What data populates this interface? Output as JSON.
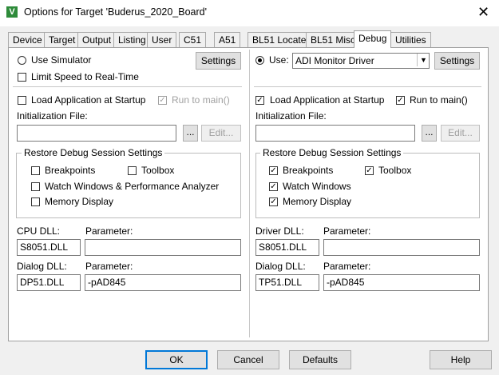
{
  "window": {
    "title": "Options for Target 'Buderus_2020_Board'",
    "app_icon": "V",
    "close_glyph": "✕"
  },
  "tabs": [
    "Device",
    "Target",
    "Output",
    "Listing",
    "User",
    "C51",
    "A51",
    "BL51 Locate",
    "BL51 Misc",
    "Debug",
    "Utilities"
  ],
  "active_tab": "Debug",
  "left": {
    "use_simulator_label": "Use Simulator",
    "use_simulator_selected": false,
    "settings_label": "Settings",
    "limit_speed_label": "Limit Speed to Real-Time",
    "limit_speed_checked": false,
    "load_app_label": "Load Application at Startup",
    "load_app_checked": false,
    "run_to_main_label": "Run to main()",
    "run_to_main_checked": true,
    "init_file_label": "Initialization File:",
    "init_file_value": "",
    "browse_label": "...",
    "edit_label": "Edit...",
    "restore_group_label": "Restore Debug Session Settings",
    "breakpoints_label": "Breakpoints",
    "breakpoints_checked": false,
    "toolbox_label": "Toolbox",
    "toolbox_checked": false,
    "watch_label": "Watch Windows & Performance Analyzer",
    "watch_checked": false,
    "memory_label": "Memory Display",
    "memory_checked": false,
    "cpu_dll_label": "CPU DLL:",
    "cpu_dll_value": "S8051.DLL",
    "cpu_param_label": "Parameter:",
    "cpu_param_value": "",
    "dialog_dll_label": "Dialog DLL:",
    "dialog_dll_value": "DP51.DLL",
    "dialog_param_label": "Parameter:",
    "dialog_param_value": "-pAD845"
  },
  "right": {
    "use_label": "Use:",
    "use_selected": true,
    "driver_value": "ADI Monitor Driver",
    "settings_label": "Settings",
    "load_app_label": "Load Application at Startup",
    "load_app_checked": true,
    "run_to_main_label": "Run to main()",
    "run_to_main_checked": true,
    "init_file_label": "Initialization File:",
    "init_file_value": "",
    "browse_label": "...",
    "edit_label": "Edit...",
    "restore_group_label": "Restore Debug Session Settings",
    "breakpoints_label": "Breakpoints",
    "breakpoints_checked": true,
    "toolbox_label": "Toolbox",
    "toolbox_checked": true,
    "watch_label": "Watch Windows",
    "watch_checked": true,
    "memory_label": "Memory Display",
    "memory_checked": true,
    "driver_dll_label": "Driver DLL:",
    "driver_dll_value": "S8051.DLL",
    "driver_param_label": "Parameter:",
    "driver_param_value": "",
    "dialog_dll_label": "Dialog DLL:",
    "dialog_dll_value": "TP51.DLL",
    "dialog_param_label": "Parameter:",
    "dialog_param_value": "-pAD845"
  },
  "footer": {
    "ok_label": "OK",
    "cancel_label": "Cancel",
    "defaults_label": "Defaults",
    "help_label": "Help"
  },
  "check_glyph": "✓",
  "dropdown_glyph": "▼"
}
